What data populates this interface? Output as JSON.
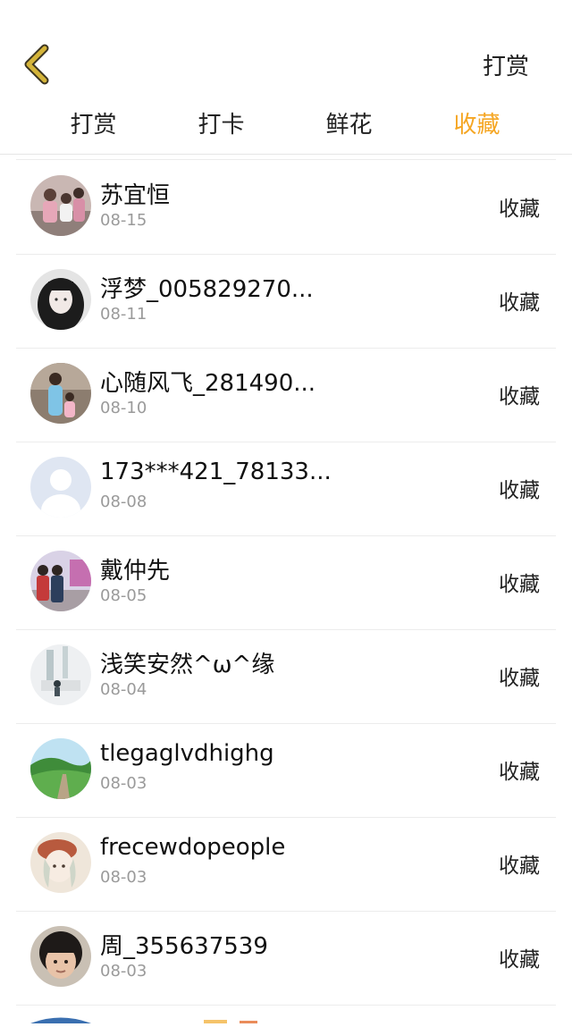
{
  "header": {
    "right_label": "打赏"
  },
  "tabs": [
    {
      "label": "打赏",
      "active": false
    },
    {
      "label": "打卡",
      "active": false
    },
    {
      "label": "鲜花",
      "active": false
    },
    {
      "label": "收藏",
      "active": true
    }
  ],
  "colors": {
    "accent": "#f5a623",
    "text": "#222222",
    "muted": "#9a9a9a",
    "divider": "#ececec",
    "back_icon": "#d4b43a"
  },
  "list": [
    {
      "name": "苏宜恒",
      "date": "08-15",
      "action": "收藏",
      "avatar_icon": "family-photo-avatar"
    },
    {
      "name": "浮梦_005829270...",
      "date": "08-11",
      "action": "收藏",
      "avatar_icon": "girl-portrait-avatar"
    },
    {
      "name": "心随风飞_281490...",
      "date": "08-10",
      "action": "收藏",
      "avatar_icon": "mother-child-avatar"
    },
    {
      "name": "173***421_78133...",
      "date": "08-08",
      "action": "收藏",
      "avatar_icon": "default-user-avatar"
    },
    {
      "name": "戴仲先",
      "date": "08-05",
      "action": "收藏",
      "avatar_icon": "couple-photo-avatar"
    },
    {
      "name": "浅笑安然^ω^缘",
      "date": "08-04",
      "action": "收藏",
      "avatar_icon": "art-illustration-avatar"
    },
    {
      "name": "tlegaglvdhighg",
      "date": "08-03",
      "action": "收藏",
      "avatar_icon": "green-landscape-avatar"
    },
    {
      "name": "frecewdopeople",
      "date": "08-03",
      "action": "收藏",
      "avatar_icon": "cartoon-girl-avatar"
    },
    {
      "name": "周_355637539",
      "date": "08-03",
      "action": "收藏",
      "avatar_icon": "child-portrait-avatar"
    }
  ]
}
